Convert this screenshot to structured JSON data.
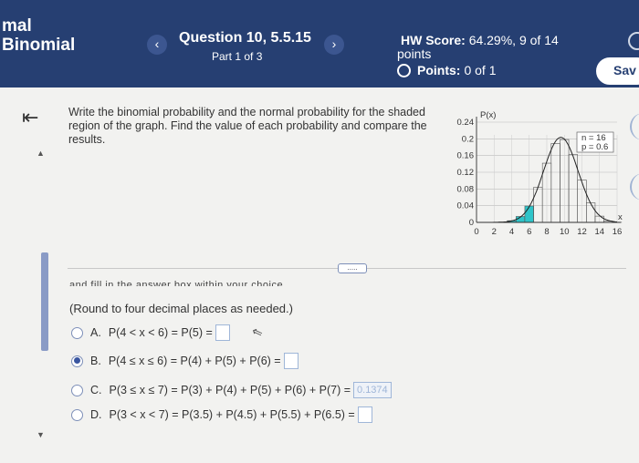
{
  "header": {
    "course_line1": "mal",
    "course_line2": "Binomial",
    "question_title": "Question 10, 5.5.15",
    "question_part": "Part 1 of 3",
    "hw_score_label": "HW Score:",
    "hw_score_value": "64.29%, 9 of 14",
    "hw_score_unit": "points",
    "points_label": "Points:",
    "points_value": "0 of 1",
    "save_label": "Sav",
    "prev_icon": "chevron-left",
    "next_icon": "chevron-right"
  },
  "question": {
    "prompt": "Write the binomial probability and the normal probability for the shaded region of the graph. Find the value of each probability and compare the results."
  },
  "graph": {
    "y_axis_label": "P(x)",
    "x_axis_label": "x",
    "legend_n": "n = 16",
    "legend_p": "p = 0.6",
    "shade_color": "#2ec4c9"
  },
  "chart_data": {
    "type": "bar",
    "title": "",
    "xlabel": "x",
    "ylabel": "P(x)",
    "xlim": [
      0,
      16
    ],
    "ylim": [
      0,
      0.24
    ],
    "y_ticks": [
      "0",
      "0.04",
      "0.08",
      "0.12",
      "0.16",
      "0.2",
      "0.24"
    ],
    "x_ticks": [
      "0",
      "2",
      "4",
      "6",
      "8",
      "10",
      "12",
      "14",
      "16"
    ],
    "x": [
      0,
      1,
      2,
      3,
      4,
      5,
      6,
      7,
      8,
      9,
      10,
      11,
      12,
      13,
      14,
      15,
      16
    ],
    "values": [
      0.0,
      0.0,
      0.0001,
      0.0008,
      0.004,
      0.0142,
      0.0392,
      0.084,
      0.1417,
      0.1889,
      0.1983,
      0.1623,
      0.1014,
      0.0468,
      0.015,
      0.003,
      0.0003
    ],
    "shaded_x": [
      4,
      5,
      6
    ],
    "annotations": [
      "n = 16",
      "p = 0.6"
    ]
  },
  "answer": {
    "cut_text": "and fill in the answer box within your choice.",
    "round_note": "(Round to four decimal places as needed.)",
    "options": [
      {
        "letter": "A.",
        "text": "P(4 < x < 6) = P(5) =",
        "selected": false,
        "box": ""
      },
      {
        "letter": "B.",
        "text": "P(4 ≤ x ≤ 6) = P(4) + P(5) + P(6) =",
        "selected": true,
        "box": ""
      },
      {
        "letter": "C.",
        "text": "P(3 ≤ x ≤ 7) = P(3) + P(4) + P(5) + P(6) + P(7) =",
        "selected": false,
        "box": "0.1374"
      },
      {
        "letter": "D.",
        "text": "P(3 < x < 7) = P(3.5) + P(4.5) + P(5.5) + P(6.5) =",
        "selected": false,
        "box": ""
      }
    ],
    "more_label": "....."
  },
  "colors": {
    "header_bg": "#263f72",
    "accent": "#3a56a0",
    "shade": "#2ec4c9"
  }
}
